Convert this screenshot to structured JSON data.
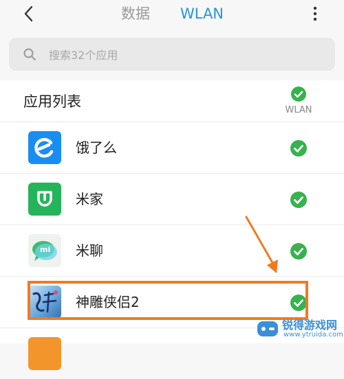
{
  "header": {
    "tabs": [
      {
        "label": "数据",
        "active": false
      },
      {
        "label": "WLAN",
        "active": true
      }
    ],
    "back_icon": "chevron-left-icon",
    "more_icon": "vertical-dots-icon"
  },
  "search": {
    "placeholder": "搜索32个应用",
    "value": "",
    "icon": "search-icon"
  },
  "app_list": {
    "title": "应用列表",
    "column_label": "WLAN",
    "all_checked": true,
    "items": [
      {
        "name": "饿了么",
        "icon": "eleme-app-icon",
        "checked": true
      },
      {
        "name": "米家",
        "icon": "mijia-app-icon",
        "checked": true
      },
      {
        "name": "米聊",
        "icon": "miliao-app-icon",
        "checked": true
      },
      {
        "name": "神雕侠侣2",
        "icon": "shendiao-app-icon",
        "checked": true,
        "highlighted": true
      }
    ]
  },
  "annotation": {
    "color": "#f07a22"
  },
  "watermark": {
    "title": "锐得游戏网",
    "url": "www.ytruida.com"
  },
  "colors": {
    "accent": "#2a93e0",
    "check_green": "#37b24d",
    "highlight": "#f07a22"
  }
}
